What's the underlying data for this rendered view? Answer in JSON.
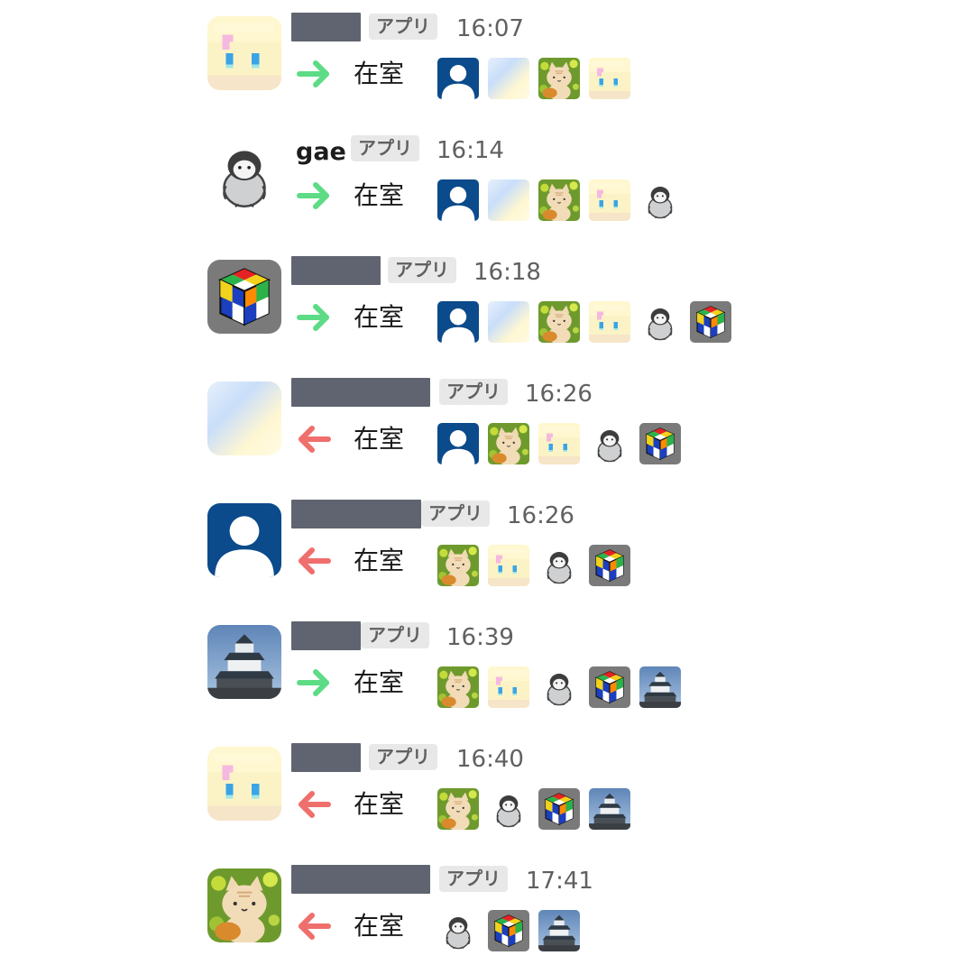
{
  "messages": [
    {
      "avatar": "pixel-girl-avatar",
      "name": "",
      "name_redacted": true,
      "badge": "アプリ",
      "time": "16:07",
      "direction": "in",
      "status": "在室",
      "present": [
        "blue-user",
        "sky-gradient",
        "cat-plush",
        "pixel-girl"
      ]
    },
    {
      "avatar": "penguin-avatar",
      "name": "gae",
      "name_redacted": false,
      "badge": "アプリ",
      "time": "16:14",
      "direction": "in",
      "status": "在室",
      "present": [
        "blue-user",
        "sky-gradient",
        "cat-plush",
        "pixel-girl",
        "penguin"
      ]
    },
    {
      "avatar": "rubik-cube-avatar",
      "name": "",
      "name_redacted": true,
      "badge": "アプリ",
      "time": "16:18",
      "direction": "in",
      "status": "在室",
      "present": [
        "blue-user",
        "sky-gradient",
        "cat-plush",
        "pixel-girl",
        "penguin",
        "rubik-cube"
      ]
    },
    {
      "avatar": "sky-gradient-avatar",
      "name": "",
      "name_redacted": true,
      "badge": "アプリ",
      "time": "16:26",
      "direction": "out",
      "status": "在室",
      "present": [
        "blue-user",
        "cat-plush",
        "pixel-girl",
        "penguin",
        "rubik-cube"
      ]
    },
    {
      "avatar": "blue-user-avatar",
      "name": "",
      "name_redacted": true,
      "badge": "アプリ",
      "time": "16:26",
      "direction": "out",
      "status": "在室",
      "present": [
        "cat-plush",
        "pixel-girl",
        "penguin",
        "rubik-cube"
      ]
    },
    {
      "avatar": "castle-avatar",
      "name": "",
      "name_redacted": true,
      "badge": "アプリ",
      "time": "16:39",
      "direction": "in",
      "status": "在室",
      "present": [
        "cat-plush",
        "pixel-girl",
        "penguin",
        "rubik-cube",
        "castle"
      ]
    },
    {
      "avatar": "pixel-girl-avatar",
      "name": "",
      "name_redacted": true,
      "badge": "アプリ",
      "time": "16:40",
      "direction": "out",
      "status": "在室",
      "present": [
        "cat-plush",
        "penguin",
        "rubik-cube",
        "castle"
      ]
    },
    {
      "avatar": "cat-plush-avatar",
      "name": "",
      "name_redacted": true,
      "badge": "アプリ",
      "time": "17:41",
      "direction": "out",
      "status": "在室",
      "present": [
        "penguin",
        "rubik-cube",
        "castle"
      ]
    }
  ],
  "colors": {
    "arrow_in": "#5edb85",
    "arrow_out": "#ef6f6c",
    "redaction": "#5f6470",
    "badge_bg": "#e8e8e8",
    "text": "#1d1c1d",
    "muted": "#616061"
  }
}
